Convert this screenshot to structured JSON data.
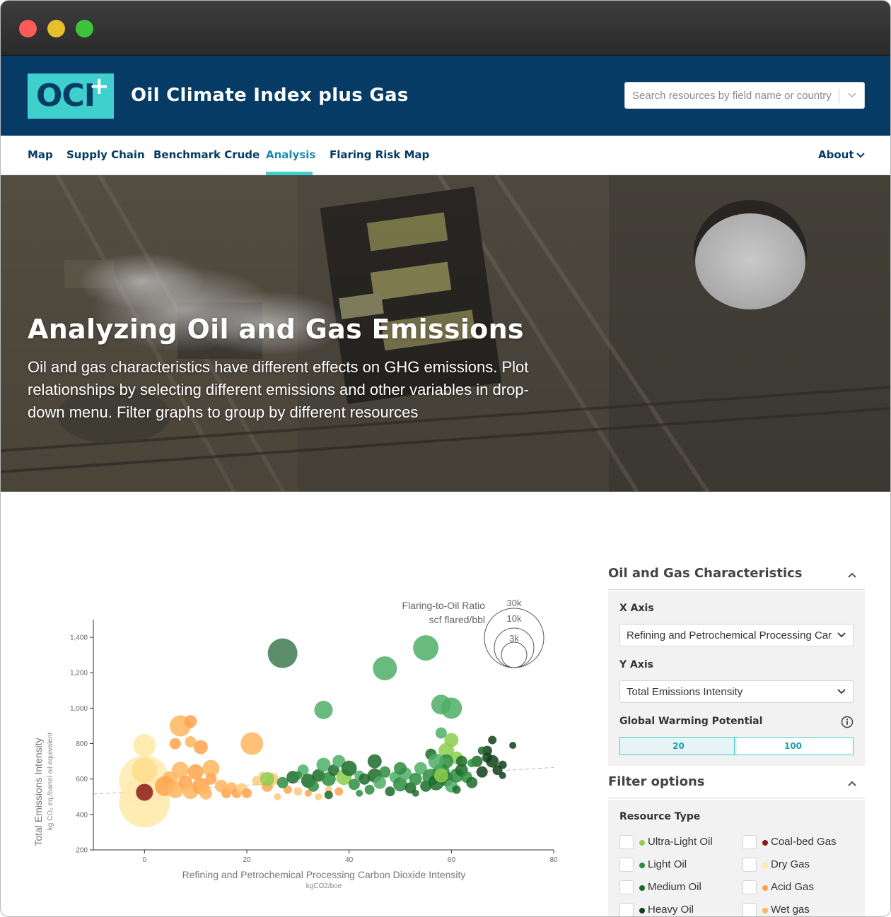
{
  "window": {
    "controls": [
      "close",
      "minimize",
      "maximize"
    ]
  },
  "header": {
    "logo_text": "OCI",
    "logo_plus": "+",
    "site_title": "Oil Climate Index plus Gas",
    "search_placeholder": "Search resources by field name or country",
    "brand_color": "#053b64",
    "accent_color": "#3fcfcd"
  },
  "nav": {
    "items": [
      {
        "label": "Map"
      },
      {
        "label": "Supply Chain"
      },
      {
        "label": "Benchmark Crude"
      },
      {
        "label": "Analysis"
      },
      {
        "label": "Flaring Risk Map"
      }
    ],
    "active": "Analysis",
    "about_label": "About"
  },
  "hero": {
    "title": "Analyzing Oil and Gas Emissions",
    "text": "Oil and gas characteristics have different effects on GHG emissions. Plot relationships by selecting different emissions and other variables in drop-down menu. Filter graphs to group by different resources"
  },
  "chart_data": {
    "type": "scatter",
    "xlabel": "Refining and Petrochemical Processing Carbon Dioxide Intensity",
    "xunit": "kgCO2/boe",
    "ylabel": "Total Emissions Intensity",
    "yunit": "kg CO₂ eq./barrel oil equivalent",
    "xlim": [
      -10,
      80
    ],
    "ylim": [
      200,
      1500
    ],
    "x_ticks": [
      "0",
      "20",
      "40",
      "60",
      "80"
    ],
    "y_ticks": [
      "200",
      "400",
      "600",
      "800",
      "1,000",
      "1,200",
      "1,400"
    ],
    "size_legend": {
      "title_line1": "Flaring-to-Oil Ratio",
      "title_line2": "scf flared/bbl",
      "labels": [
        "30k",
        "10k",
        "3k"
      ]
    },
    "trend_line": {
      "x": [
        -10,
        80
      ],
      "y": [
        515,
        665
      ]
    },
    "points": [
      {
        "x": 27,
        "y": 1310,
        "r": 21,
        "c": "#3f7a52"
      },
      {
        "x": 55,
        "y": 1340,
        "r": 18,
        "c": "#4fae66"
      },
      {
        "x": 47,
        "y": 1225,
        "r": 17,
        "c": "#4fae66"
      },
      {
        "x": 35,
        "y": 990,
        "r": 13,
        "c": "#4fae66"
      },
      {
        "x": 60,
        "y": 1000,
        "r": 15,
        "c": "#4fae66"
      },
      {
        "x": 58,
        "y": 1020,
        "r": 14,
        "c": "#4fae66"
      },
      {
        "x": 0,
        "y": 470,
        "r": 36,
        "c": "#ffe9a6"
      },
      {
        "x": 0,
        "y": 590,
        "r": 36,
        "c": "#ffeab0"
      },
      {
        "x": 0,
        "y": 790,
        "r": 16,
        "c": "#ffe9a6"
      },
      {
        "x": 0,
        "y": 650,
        "r": 18,
        "c": "#ffdd8a"
      },
      {
        "x": 0,
        "y": 525,
        "r": 12,
        "c": "#8b1a1a"
      },
      {
        "x": 7,
        "y": 900,
        "r": 15,
        "c": "#ffb660"
      },
      {
        "x": 9,
        "y": 925,
        "r": 9,
        "c": "#ffa34d"
      },
      {
        "x": 21,
        "y": 800,
        "r": 16,
        "c": "#ffb660"
      },
      {
        "x": 6,
        "y": 800,
        "r": 8,
        "c": "#ffa34d"
      },
      {
        "x": 9,
        "y": 810,
        "r": 8,
        "c": "#ffb660"
      },
      {
        "x": 11,
        "y": 780,
        "r": 10,
        "c": "#ffa34d"
      },
      {
        "x": 13,
        "y": 660,
        "r": 12,
        "c": "#ffb660"
      },
      {
        "x": 7,
        "y": 650,
        "r": 12,
        "c": "#ffb660"
      },
      {
        "x": 10,
        "y": 640,
        "r": 11,
        "c": "#ffa34d"
      },
      {
        "x": 5,
        "y": 600,
        "r": 11,
        "c": "#ffb660"
      },
      {
        "x": 4,
        "y": 560,
        "r": 14,
        "c": "#ffa34d"
      },
      {
        "x": 6,
        "y": 540,
        "r": 12,
        "c": "#ffb660"
      },
      {
        "x": 8,
        "y": 580,
        "r": 10,
        "c": "#ffa34d"
      },
      {
        "x": 9,
        "y": 530,
        "r": 11,
        "c": "#ffb660"
      },
      {
        "x": 11,
        "y": 560,
        "r": 12,
        "c": "#ffa34d"
      },
      {
        "x": 12,
        "y": 520,
        "r": 9,
        "c": "#ffb660"
      },
      {
        "x": 13,
        "y": 600,
        "r": 8,
        "c": "#ffa34d"
      },
      {
        "x": 15,
        "y": 560,
        "r": 9,
        "c": "#ffb660"
      },
      {
        "x": 16,
        "y": 520,
        "r": 7,
        "c": "#ffa34d"
      },
      {
        "x": 17,
        "y": 550,
        "r": 8,
        "c": "#ffb660"
      },
      {
        "x": 18,
        "y": 520,
        "r": 7,
        "c": "#ffa34d"
      },
      {
        "x": 19,
        "y": 545,
        "r": 8,
        "c": "#ffc97a"
      },
      {
        "x": 20,
        "y": 520,
        "r": 7,
        "c": "#ffa34d"
      },
      {
        "x": 22,
        "y": 590,
        "r": 7,
        "c": "#ffc97a"
      },
      {
        "x": 24,
        "y": 560,
        "r": 8,
        "c": "#ffa34d"
      },
      {
        "x": 25,
        "y": 600,
        "r": 9,
        "c": "#ffc97a"
      },
      {
        "x": 23,
        "y": 620,
        "r": 5,
        "c": "#ffc97a"
      },
      {
        "x": 26,
        "y": 500,
        "r": 5,
        "c": "#ffc97a"
      },
      {
        "x": 28,
        "y": 540,
        "r": 6,
        "c": "#ffa34d"
      },
      {
        "x": 30,
        "y": 530,
        "r": 6,
        "c": "#ffc97a"
      },
      {
        "x": 32,
        "y": 520,
        "r": 5,
        "c": "#ffa34d"
      },
      {
        "x": 34,
        "y": 500,
        "r": 5,
        "c": "#ffc97a"
      },
      {
        "x": 36,
        "y": 540,
        "r": 5,
        "c": "#ffc97a"
      },
      {
        "x": 38,
        "y": 530,
        "r": 6,
        "c": "#ffa34d"
      },
      {
        "x": 24,
        "y": 600,
        "r": 10,
        "c": "#8ccf4d"
      },
      {
        "x": 27,
        "y": 580,
        "r": 8,
        "c": "#2e8c3e"
      },
      {
        "x": 29,
        "y": 610,
        "r": 9,
        "c": "#1d6b2c"
      },
      {
        "x": 31,
        "y": 650,
        "r": 8,
        "c": "#4fae66"
      },
      {
        "x": 32,
        "y": 590,
        "r": 10,
        "c": "#1d6b2c"
      },
      {
        "x": 33,
        "y": 560,
        "r": 8,
        "c": "#2e8c3e"
      },
      {
        "x": 34,
        "y": 620,
        "r": 9,
        "c": "#1d6b2c"
      },
      {
        "x": 35,
        "y": 680,
        "r": 10,
        "c": "#4fae66"
      },
      {
        "x": 36,
        "y": 600,
        "r": 10,
        "c": "#2e8c3e"
      },
      {
        "x": 37,
        "y": 650,
        "r": 8,
        "c": "#1d6b2c"
      },
      {
        "x": 38,
        "y": 700,
        "r": 9,
        "c": "#4fae66"
      },
      {
        "x": 39,
        "y": 610,
        "r": 11,
        "c": "#8ccf4d"
      },
      {
        "x": 40,
        "y": 660,
        "r": 11,
        "c": "#1d6b2c"
      },
      {
        "x": 41,
        "y": 570,
        "r": 8,
        "c": "#2e8c3e"
      },
      {
        "x": 42,
        "y": 620,
        "r": 7,
        "c": "#4fae66"
      },
      {
        "x": 43,
        "y": 600,
        "r": 8,
        "c": "#1d6b2c"
      },
      {
        "x": 44,
        "y": 540,
        "r": 7,
        "c": "#2e8c3e"
      },
      {
        "x": 45,
        "y": 620,
        "r": 10,
        "c": "#1d6b2c"
      },
      {
        "x": 46,
        "y": 580,
        "r": 9,
        "c": "#4fae66"
      },
      {
        "x": 47,
        "y": 640,
        "r": 8,
        "c": "#2e8c3e"
      },
      {
        "x": 48,
        "y": 530,
        "r": 7,
        "c": "#1d6b2c"
      },
      {
        "x": 49,
        "y": 610,
        "r": 8,
        "c": "#4fae66"
      },
      {
        "x": 50,
        "y": 570,
        "r": 10,
        "c": "#2e8c3e"
      },
      {
        "x": 51,
        "y": 630,
        "r": 9,
        "c": "#4fae66"
      },
      {
        "x": 52,
        "y": 550,
        "r": 8,
        "c": "#1d6b2c"
      },
      {
        "x": 53,
        "y": 600,
        "r": 9,
        "c": "#2e8c3e"
      },
      {
        "x": 54,
        "y": 660,
        "r": 9,
        "c": "#4fae66"
      },
      {
        "x": 55,
        "y": 560,
        "r": 8,
        "c": "#1d6b2c"
      },
      {
        "x": 56,
        "y": 610,
        "r": 12,
        "c": "#2e8c3e"
      },
      {
        "x": 57,
        "y": 580,
        "r": 11,
        "c": "#1d6b2c"
      },
      {
        "x": 58,
        "y": 640,
        "r": 12,
        "c": "#2e8c3e"
      },
      {
        "x": 59,
        "y": 600,
        "r": 10,
        "c": "#1d6b2c"
      },
      {
        "x": 60,
        "y": 560,
        "r": 9,
        "c": "#4fae66"
      },
      {
        "x": 61,
        "y": 620,
        "r": 10,
        "c": "#2e8c3e"
      },
      {
        "x": 62,
        "y": 650,
        "r": 9,
        "c": "#1d6b2c"
      },
      {
        "x": 63,
        "y": 610,
        "r": 8,
        "c": "#2e8c3e"
      },
      {
        "x": 64,
        "y": 580,
        "r": 8,
        "c": "#1d6b2c"
      },
      {
        "x": 65,
        "y": 700,
        "r": 8,
        "c": "#1d6b2c"
      },
      {
        "x": 66,
        "y": 640,
        "r": 8,
        "c": "#0f3f1a"
      },
      {
        "x": 67,
        "y": 760,
        "r": 7,
        "c": "#0f3f1a"
      },
      {
        "x": 68,
        "y": 700,
        "r": 9,
        "c": "#0f3f1a"
      },
      {
        "x": 69,
        "y": 650,
        "r": 7,
        "c": "#0f3f1a"
      },
      {
        "x": 70,
        "y": 680,
        "r": 6,
        "c": "#0f3f1a"
      },
      {
        "x": 72,
        "y": 790,
        "r": 5,
        "c": "#0f3f1a"
      },
      {
        "x": 70,
        "y": 620,
        "r": 5,
        "c": "#0f3f1a"
      },
      {
        "x": 68,
        "y": 820,
        "r": 6,
        "c": "#0f3f1a"
      },
      {
        "x": 60,
        "y": 820,
        "r": 10,
        "c": "#8ccf4d"
      },
      {
        "x": 58,
        "y": 860,
        "r": 8,
        "c": "#4fae66"
      },
      {
        "x": 59,
        "y": 760,
        "r": 11,
        "c": "#8ccf4d"
      },
      {
        "x": 61,
        "y": 720,
        "r": 9,
        "c": "#8ccf4d"
      },
      {
        "x": 59,
        "y": 700,
        "r": 10,
        "c": "#2e8c3e"
      },
      {
        "x": 45,
        "y": 700,
        "r": 10,
        "c": "#1d6b2c"
      },
      {
        "x": 50,
        "y": 660,
        "r": 9,
        "c": "#2e8c3e"
      },
      {
        "x": 56,
        "y": 740,
        "r": 8,
        "c": "#1d6b2c"
      },
      {
        "x": 57,
        "y": 700,
        "r": 11,
        "c": "#4fae66"
      },
      {
        "x": 42,
        "y": 520,
        "r": 5,
        "c": "#2e8c3e"
      },
      {
        "x": 36,
        "y": 510,
        "r": 6,
        "c": "#1d6b2c"
      },
      {
        "x": 30,
        "y": 620,
        "r": 6,
        "c": "#2e8c3e"
      },
      {
        "x": 53,
        "y": 520,
        "r": 5,
        "c": "#1d6b2c"
      },
      {
        "x": 61,
        "y": 540,
        "r": 6,
        "c": "#1d6b2c"
      },
      {
        "x": 64,
        "y": 690,
        "r": 6,
        "c": "#2e8c3e"
      },
      {
        "x": 66,
        "y": 760,
        "r": 6,
        "c": "#1d6b2c"
      },
      {
        "x": 67,
        "y": 720,
        "r": 7,
        "c": "#0f3f1a"
      },
      {
        "x": 62,
        "y": 700,
        "r": 8,
        "c": "#1d6b2c"
      },
      {
        "x": 58,
        "y": 620,
        "r": 10,
        "c": "#8ccf4d"
      }
    ]
  },
  "panel": {
    "characteristics": {
      "title": "Oil and Gas Characteristics",
      "x_axis_label": "X Axis",
      "x_axis_value": "Refining and Petrochemical Processing Carbon Dioxide Intensity",
      "y_axis_label": "Y Axis",
      "y_axis_value": "Total Emissions Intensity",
      "gwp_label": "Global Warming Potential",
      "gwp_options": [
        "20",
        "100"
      ],
      "gwp_selected": "20"
    },
    "filters": {
      "title": "Filter options",
      "resource_type_label": "Resource Type",
      "resources": [
        {
          "label": "Ultra-Light Oil",
          "color": "#8ccf4d"
        },
        {
          "label": "Coal-bed Gas",
          "color": "#8b1a1a"
        },
        {
          "label": "Light Oil",
          "color": "#2e8c3e"
        },
        {
          "label": "Dry Gas",
          "color": "#ffe9a6"
        },
        {
          "label": "Medium Oil",
          "color": "#1d6b2c"
        },
        {
          "label": "Acid Gas",
          "color": "#ff9f4a"
        },
        {
          "label": "Heavy Oil",
          "color": "#0f3f1a"
        },
        {
          "label": "Wet gas",
          "color": "#ffb660"
        }
      ]
    }
  }
}
